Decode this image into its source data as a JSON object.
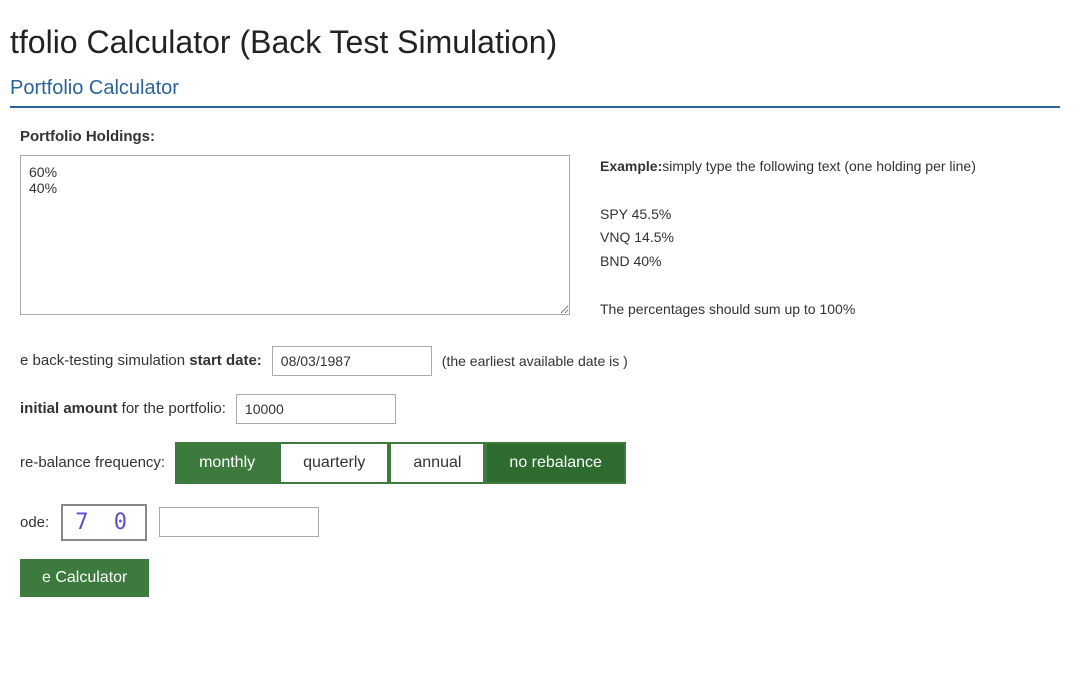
{
  "page": {
    "title": "tfolio Calculator (Back Test Simulation)",
    "section_title": "Portfolio Calculator"
  },
  "form": {
    "holdings_label": "Portfolio Holdings:",
    "holdings_placeholder": "",
    "holdings_value": "60%\n40%",
    "example_label": "Example:",
    "example_description": "simply type the following text (one holding per line)",
    "example_lines": [
      "SPY 45.5%",
      "VNQ 14.5%",
      "BND 40%"
    ],
    "example_note": "The percentages should sum up to 100%",
    "start_date_label": "e back-testing simulation",
    "start_date_label_bold": "start date:",
    "start_date_value": "08/03/1987",
    "start_date_note": "(the earliest available date is )",
    "amount_label": "initial amount",
    "amount_label_suffix": "for the portfolio:",
    "amount_value": "10000",
    "rebalance_label": "re-balance frequency:",
    "rebalance_buttons": [
      {
        "label": "monthly",
        "active": true
      },
      {
        "label": "quarterly",
        "active": false
      },
      {
        "label": "annual",
        "active": false
      },
      {
        "label": "no rebalance",
        "active": true
      }
    ],
    "captcha_label": "ode:",
    "captcha_value": "7 0",
    "captcha_input_placeholder": "",
    "submit_label": "e Calculator"
  },
  "colors": {
    "green_active": "#3d7a3d",
    "green_dark": "#2e6b2e",
    "section_border": "#2a6496"
  }
}
